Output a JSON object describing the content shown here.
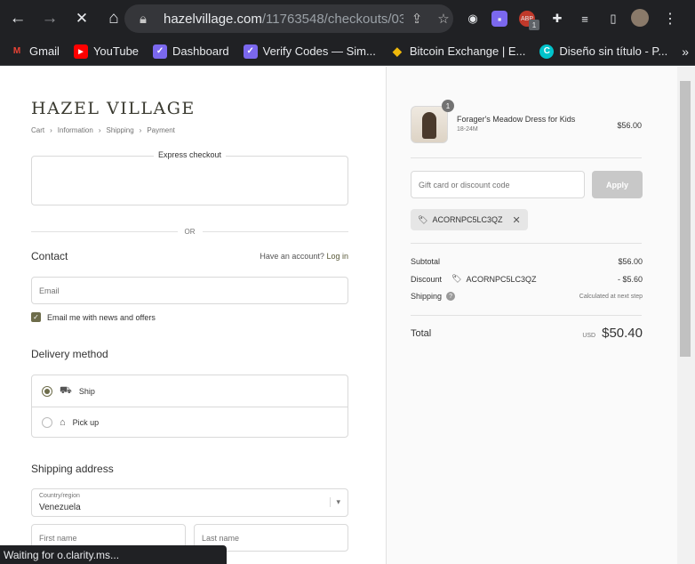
{
  "browser": {
    "url_host": "hazelvillage.com",
    "url_path": "/11763548/checkouts/03...",
    "ext_badge": "1",
    "status_text": "Waiting for o.clarity.ms..."
  },
  "bookmarks": [
    {
      "label": "Gmail",
      "icon": "gmail-icon",
      "color": "#ea4335"
    },
    {
      "label": "YouTube",
      "icon": "youtube-icon",
      "color": "#ff0000"
    },
    {
      "label": "Dashboard",
      "icon": "dashboard-icon",
      "color": "#7b68ee"
    },
    {
      "label": "Verify Codes — Sim...",
      "icon": "verify-icon",
      "color": "#7b68ee"
    },
    {
      "label": "Bitcoin Exchange | E...",
      "icon": "binance-icon",
      "color": "#f0b90b"
    },
    {
      "label": "Diseño sin título - P...",
      "icon": "canva-icon",
      "color": "#00c4cc"
    }
  ],
  "checkout": {
    "brand": "HAZEL VILLAGE",
    "breadcrumbs": [
      "Cart",
      "Information",
      "Shipping",
      "Payment"
    ],
    "express_label": "Express checkout",
    "or_label": "OR",
    "contact_title": "Contact",
    "have_account": "Have an account?",
    "login_link": "Log in",
    "email_placeholder": "Email",
    "news_label": "Email me with news and offers",
    "delivery_title": "Delivery method",
    "delivery_options": [
      {
        "label": "Ship",
        "selected": true,
        "icon": "truck-icon"
      },
      {
        "label": "Pick up",
        "selected": false,
        "icon": "store-icon"
      }
    ],
    "shipping_title": "Shipping address",
    "country_label": "Country/region",
    "country_value": "Venezuela",
    "first_name_placeholder": "First name",
    "last_name_placeholder": "Last name"
  },
  "summary": {
    "product": {
      "quantity": "1",
      "name": "Forager's Meadow Dress for Kids",
      "variant": "18-24M",
      "price": "$56.00"
    },
    "gift_placeholder": "Gift card or discount code",
    "apply_label": "Apply",
    "discount_code": "ACORNPC5LC3QZ",
    "subtotal_label": "Subtotal",
    "subtotal_value": "$56.00",
    "discount_label": "Discount",
    "discount_value": "- $5.60",
    "shipping_label": "Shipping",
    "shipping_value": "Calculated at next step",
    "total_label": "Total",
    "currency": "USD",
    "total_value": "$50.40"
  },
  "colors": {
    "accent": "#6d6c4a",
    "chrome_bg": "#202124"
  }
}
